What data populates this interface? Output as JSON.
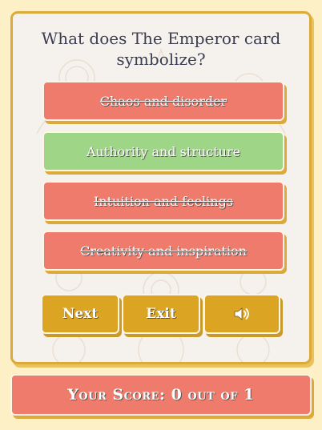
{
  "quiz": {
    "question": "What does The Emperor card symbolize?",
    "answers": [
      {
        "label": "Chaos and disorder",
        "state": "wrong"
      },
      {
        "label": "Authority and structure",
        "state": "correct"
      },
      {
        "label": "Intuition and feelings",
        "state": "wrong"
      },
      {
        "label": "Creativity and inspiration",
        "state": "wrong"
      }
    ]
  },
  "controls": {
    "next_label": "Next",
    "exit_label": "Exit",
    "sound_icon": "speaker-icon"
  },
  "score": {
    "text": "Your Score: 0 out of 1"
  },
  "colors": {
    "page_bg": "#fdf0c6",
    "card_bg": "#f5f1ec",
    "gold": "#dba523",
    "wrong": "#ee7b6c",
    "correct": "#9ed586",
    "question_text": "#3b3e52"
  }
}
